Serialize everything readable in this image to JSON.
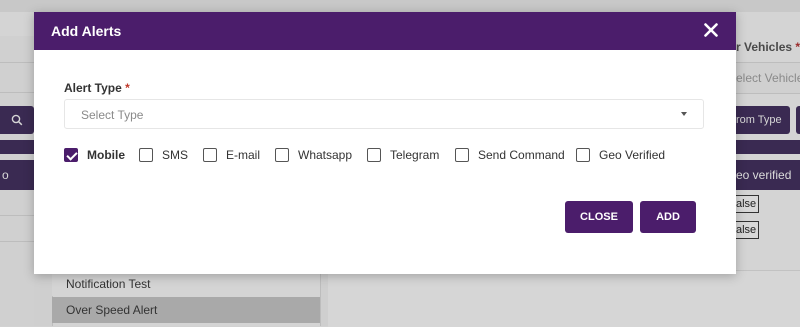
{
  "modal": {
    "title": "Add Alerts",
    "close_icon": "close-icon",
    "alert_type": {
      "label": "Alert Type",
      "required_mark": "*",
      "placeholder": "Select Type",
      "caret_icon": "chevron-down-icon"
    },
    "channels": [
      {
        "label": "Mobile",
        "checked": true
      },
      {
        "label": "SMS",
        "checked": false
      },
      {
        "label": "E-mail",
        "checked": false
      },
      {
        "label": "Whatsapp",
        "checked": false
      },
      {
        "label": "Telegram",
        "checked": false
      },
      {
        "label": "Send Command",
        "checked": false
      },
      {
        "label": "Geo Verified",
        "checked": false
      }
    ],
    "buttons": {
      "close": "CLOSE",
      "add": "ADD"
    },
    "colors": {
      "primary": "#4b1d6b",
      "required": "#c0392b"
    }
  },
  "background": {
    "vehicles_label": "r Vehicles",
    "vehicles_required": "*",
    "select_vehicle": "elect Vehicle",
    "from_type_button": "rom Type",
    "geo_verified_header": "eo verified",
    "left_header_fragment": "o",
    "false_badges": [
      "alse",
      "alse"
    ],
    "search_icon": "search-icon",
    "list_items": [
      "Notification Test",
      "Over Speed Alert"
    ]
  }
}
